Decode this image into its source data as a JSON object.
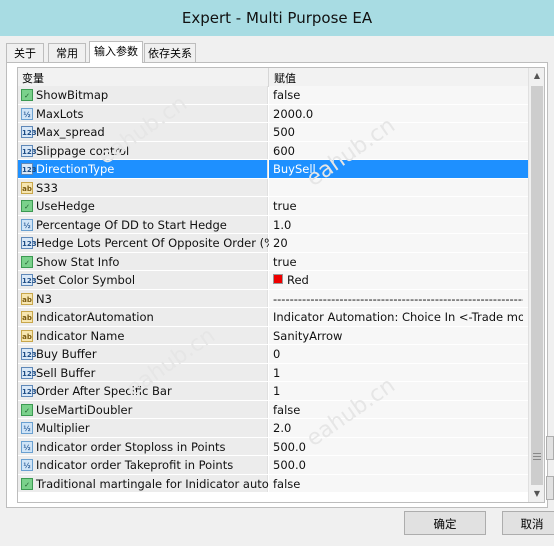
{
  "window": {
    "title": "Expert - Multi Purpose EA"
  },
  "tabs": [
    {
      "label": "关于",
      "active": false
    },
    {
      "label": "常用",
      "active": false
    },
    {
      "label": "输入参数",
      "active": true
    },
    {
      "label": "依存关系",
      "active": false
    }
  ],
  "grid": {
    "col_name": "变量",
    "col_value": "赋值",
    "rows": [
      {
        "icon": "bool-icon",
        "name": "ShowBitmap",
        "value": "false"
      },
      {
        "icon": "double-icon",
        "name": "MaxLots",
        "value": "2000.0"
      },
      {
        "icon": "int-icon",
        "name": "Max_spread",
        "value": "500"
      },
      {
        "icon": "int-icon",
        "name": "Slippage control",
        "value": "600"
      },
      {
        "icon": "int-icon",
        "name": "DirectionType",
        "value": "BuySell",
        "selected": true
      },
      {
        "icon": "string-icon",
        "name": "S33",
        "value": ""
      },
      {
        "icon": "bool-icon",
        "name": "UseHedge",
        "value": "true"
      },
      {
        "icon": "double-icon",
        "name": "Percentage Of DD to Start Hedge",
        "value": "1.0"
      },
      {
        "icon": "int-icon",
        "name": "Hedge Lots Percent Of Opposite Order (%)",
        "value": "20"
      },
      {
        "icon": "bool-icon",
        "name": "Show Stat Info",
        "value": "true"
      },
      {
        "icon": "int-icon",
        "name": "Set Color Symbol",
        "value": "Red",
        "color": "#ee0000"
      },
      {
        "icon": "string-icon",
        "name": "N3",
        "value": "----------------------------------------------------------------"
      },
      {
        "icon": "string-icon",
        "name": "IndicatorAutomation",
        "value": "Indicator Automation: Choice In <-Trade mo..."
      },
      {
        "icon": "string-icon",
        "name": "Indicator Name",
        "value": "SanityArrow"
      },
      {
        "icon": "int-icon",
        "name": "Buy Buffer",
        "value": "0"
      },
      {
        "icon": "int-icon",
        "name": "Sell Buffer",
        "value": "1"
      },
      {
        "icon": "int-icon",
        "name": "Order After Specific Bar",
        "value": "1"
      },
      {
        "icon": "bool-icon",
        "name": "UseMartiDoubler",
        "value": "false"
      },
      {
        "icon": "double-icon",
        "name": "Multiplier",
        "value": "2.0"
      },
      {
        "icon": "double-icon",
        "name": "Indicator order Stoploss in Points",
        "value": "500.0"
      },
      {
        "icon": "double-icon",
        "name": "Indicator order Takeprofit in Points",
        "value": "500.0"
      },
      {
        "icon": "bool-icon",
        "name": "Traditional martingale for Inidicator auto...",
        "value": "false"
      }
    ]
  },
  "buttons": {
    "ok": "确定",
    "cancel": "取消"
  },
  "watermark": "eahub.cn",
  "colors": {
    "titlebar": "#a8dce3",
    "selection": "#1e90ff"
  }
}
